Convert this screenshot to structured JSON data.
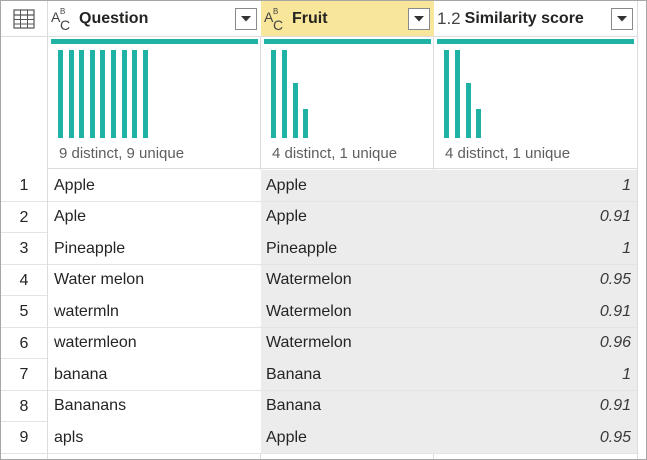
{
  "columns": [
    {
      "type_icon": "ABC",
      "title": "Question",
      "profile": "9 distinct, 9 unique",
      "bars": [
        1,
        1,
        1,
        1,
        1,
        1,
        1,
        1,
        1
      ],
      "selected": false
    },
    {
      "type_icon": "ABC",
      "title": "Fruit",
      "profile": "4 distinct, 1 unique",
      "bars": [
        1,
        1,
        0.62,
        0.33
      ],
      "selected": true
    },
    {
      "type_icon": "1.2",
      "title": "Similarity score",
      "profile": "4 distinct, 1 unique",
      "bars": [
        1,
        1,
        0.62,
        0.33
      ],
      "selected": false
    }
  ],
  "abc": {
    "a": "A",
    "b": "B",
    "c": "C"
  },
  "rows": [
    {
      "n": "1",
      "q": "Apple",
      "f": "Apple",
      "s": "1"
    },
    {
      "n": "2",
      "q": "Aple",
      "f": "Apple",
      "s": "0.91"
    },
    {
      "n": "3",
      "q": "Pineapple",
      "f": "Pineapple",
      "s": "1"
    },
    {
      "n": "4",
      "q": "Water melon",
      "f": "Watermelon",
      "s": "0.95"
    },
    {
      "n": "5",
      "q": "watermln",
      "f": "Watermelon",
      "s": "0.91"
    },
    {
      "n": "6",
      "q": "watermleon",
      "f": "Watermelon",
      "s": "0.96"
    },
    {
      "n": "7",
      "q": "banana",
      "f": "Banana",
      "s": "1"
    },
    {
      "n": "8",
      "q": "Bananans",
      "f": "Banana",
      "s": "0.91"
    },
    {
      "n": "9",
      "q": "apls",
      "f": "Apple",
      "s": "0.95"
    }
  ],
  "colors": {
    "accent": "#1fb3a6",
    "selected_header": "#f8e69a",
    "cell_shaded": "#ececec"
  }
}
